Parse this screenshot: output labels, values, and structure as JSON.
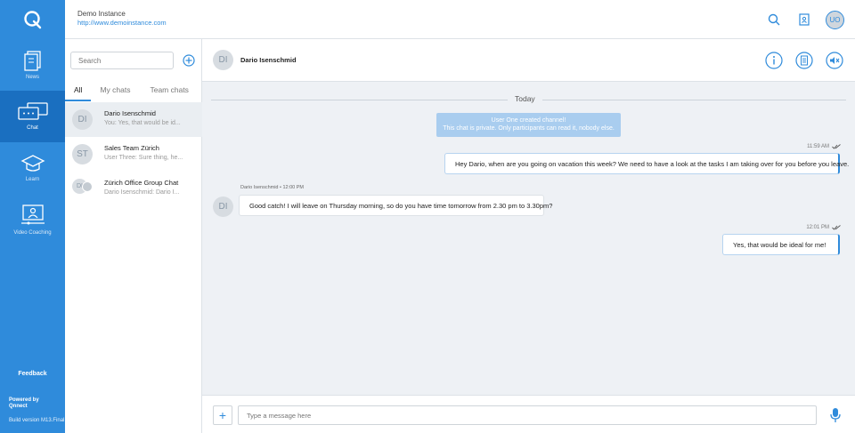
{
  "nav": {
    "items": [
      {
        "label": "News",
        "icon": "news-icon"
      },
      {
        "label": "Chat",
        "icon": "chat-icon"
      },
      {
        "label": "Learn",
        "icon": "learn-icon"
      },
      {
        "label": "Video Coaching",
        "icon": "video-coaching-icon"
      }
    ],
    "feedback": "Feedback",
    "powered_by": "Powered by",
    "powered_name": "Qnnect",
    "build": "Build version M13.Final"
  },
  "header": {
    "instance_name": "Demo Instance",
    "instance_url": "http://www.demoinstance.com",
    "avatar_initials": "UO"
  },
  "chat_list": {
    "search_placeholder": "Search",
    "tabs": [
      {
        "label": "All"
      },
      {
        "label": "My chats"
      },
      {
        "label": "Team chats"
      }
    ],
    "items": [
      {
        "initials": "DI",
        "name": "Dario Isenschmid",
        "preview": "You: Yes, that would be id..."
      },
      {
        "initials": "ST",
        "name": "Sales Team Zürich",
        "preview": "User Three: Sure thing, he..."
      },
      {
        "initials": "DI",
        "name": "Zürich Office Group Chat",
        "preview": "Dario Isenschmid: Dario I..."
      }
    ]
  },
  "conversation": {
    "initials": "DI",
    "title": "Dario Isenschmid",
    "date_label": "Today",
    "system_line1": "User One created channel!",
    "system_line2": "This chat is private. Only participants can read it, nobody else.",
    "messages": [
      {
        "time": "11:59 AM",
        "text": "Hey Dario, when are you going on vacation this week? We need to have a look at the tasks I am taking over for you before you leave."
      },
      {
        "sender": "Dario Isenschmid • 12:00 PM",
        "initials": "DI",
        "text": "Good catch! I will leave on Thursday morning, so do you have time tomorrow from 2.30 pm to 3.30pm?"
      },
      {
        "time": "12:01 PM",
        "text": "Yes, that would be ideal for me!"
      }
    ],
    "composer_placeholder": "Type a message here",
    "add_label": "+"
  },
  "colors": {
    "accent": "#2f8bdb",
    "nav_active": "#1a6fc0"
  }
}
